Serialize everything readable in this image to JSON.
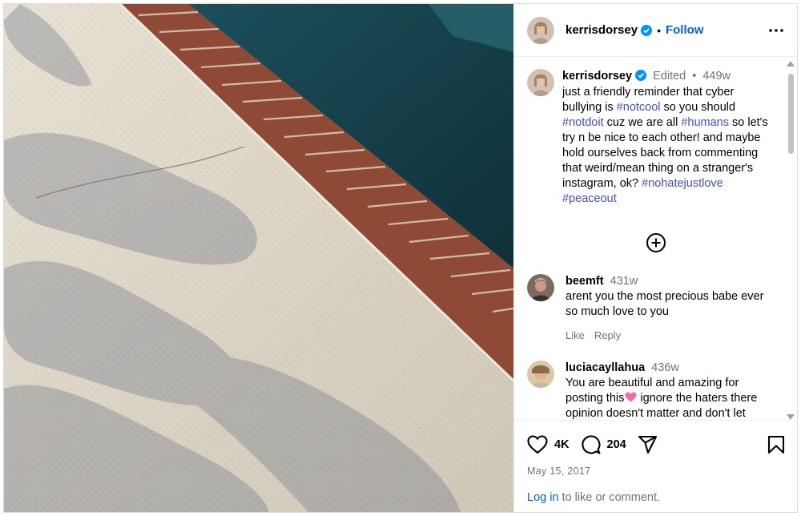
{
  "post": {
    "author": "kerrisdorsey",
    "follow_label": "Follow",
    "separator": "•"
  },
  "caption": {
    "author": "kerrisdorsey",
    "edited_label": "Edited",
    "separator": "•",
    "age": "449w",
    "text_1": "just a friendly reminder that cyber bullying is ",
    "tag_1": "#notcool",
    "text_2": " so you should ",
    "tag_2": "#notdoit",
    "text_3": " cuz we are all ",
    "tag_3": "#humans",
    "text_4": " so let's try n be nice to each other! and maybe hold ourselves back from commenting that weird/mean thing on a stranger's instagram, ok? ",
    "tag_4": "#nohatejustlove",
    "text_5": " ",
    "tag_5": "#peaceout"
  },
  "comments": [
    {
      "user": "beemft",
      "age": "431w",
      "text": "arent you the most precious babe ever so much love to you",
      "like_label": "Like",
      "reply_label": "Reply"
    },
    {
      "user": "luciacayllahua",
      "age": "436w",
      "text_before_emoji": "You are beautiful and amazing for posting this",
      "text_after_emoji": " ignore the haters there opinion doesn't matter and don't let"
    }
  ],
  "stats": {
    "likes": "4K",
    "comments": "204",
    "date": "May 15, 2017"
  },
  "login": {
    "link": "Log in",
    "rest": " to like or comment."
  },
  "colors": {
    "link": "#0064e0",
    "hashtag": "#4350c7",
    "muted": "#737373",
    "verified": "#0095f6"
  },
  "icons": {
    "verified": "verified-badge-icon",
    "more": "more-options-icon",
    "add": "plus-circle-icon",
    "like": "heart-icon",
    "comment": "comment-bubble-icon",
    "share": "paper-plane-icon",
    "save": "bookmark-icon",
    "heart_emoji": "pink-heart-emoji-icon"
  }
}
